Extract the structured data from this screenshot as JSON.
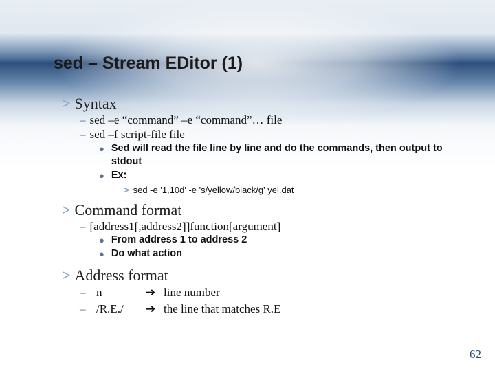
{
  "title": "sed – Stream EDitor (1)",
  "sections": {
    "syntax": {
      "heading": "Syntax",
      "lines": [
        "sed –e “command” –e “command”… file",
        "sed –f script-file file"
      ],
      "bullets": [
        "Sed will read the file line by line and do the commands, then output to stdout",
        "Ex:"
      ],
      "example": "sed -e '1,10d' -e 's/yellow/black/g' yel.dat"
    },
    "command": {
      "heading": "Command format",
      "lines": [
        "[address1[,address2]]function[argument]"
      ],
      "bullets": [
        "From address 1 to address 2",
        "Do what action"
      ]
    },
    "address": {
      "heading": "Address format",
      "rows": [
        {
          "sym": "n",
          "desc": "line number"
        },
        {
          "sym": "/R.E./",
          "desc": "the line that matches R.E"
        }
      ]
    }
  },
  "page_number": "62"
}
